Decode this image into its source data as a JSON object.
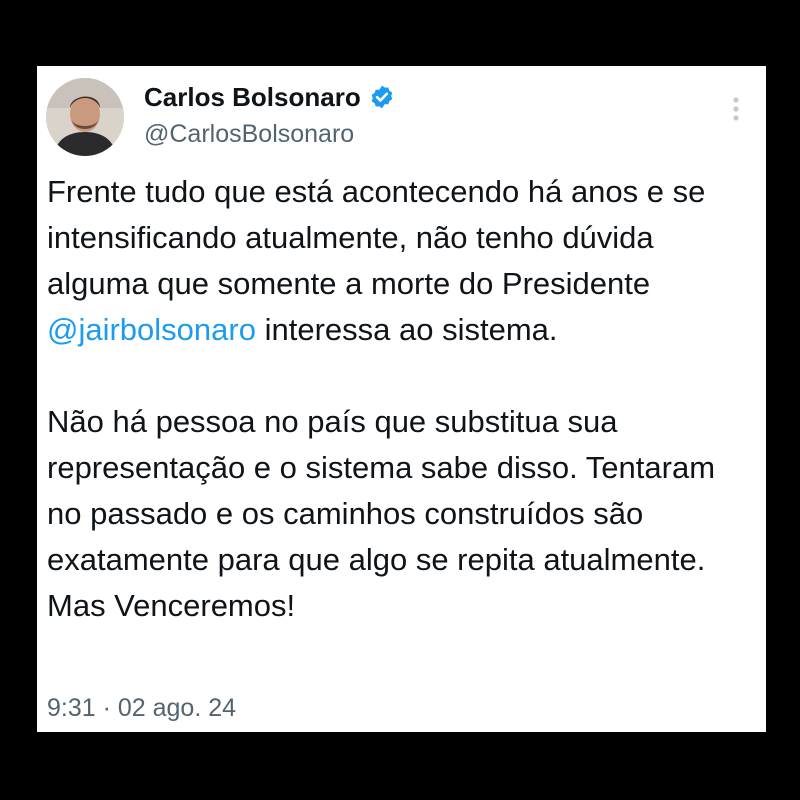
{
  "tweet": {
    "author": {
      "display_name": "Carlos Bolsonaro",
      "handle": "@CarlosBolsonaro",
      "verified": true
    },
    "menu_icon": "more-vertical-icon",
    "paragraph1": {
      "before_mention": "Frente tudo que está acontecendo há anos e se intensificando atualmente, não tenho dúvida alguma que somente a morte do Presidente ",
      "mention": "@jairbolsonaro",
      "after_mention": " interessa ao sistema."
    },
    "paragraph2": "Não há pessoa no país que substitua sua representação e o sistema sabe disso. Tentaram  no passado e os caminhos construídos são exatamente para que algo se repita atualmente. Mas Venceremos!",
    "timestamp": "9:31 · 02 ago. 24"
  },
  "colors": {
    "background": "#000000",
    "card": "#ffffff",
    "text": "#0f1419",
    "secondary_text": "#536471",
    "link": "#1d9bf0",
    "verified_badge": "#1d9bf0"
  }
}
